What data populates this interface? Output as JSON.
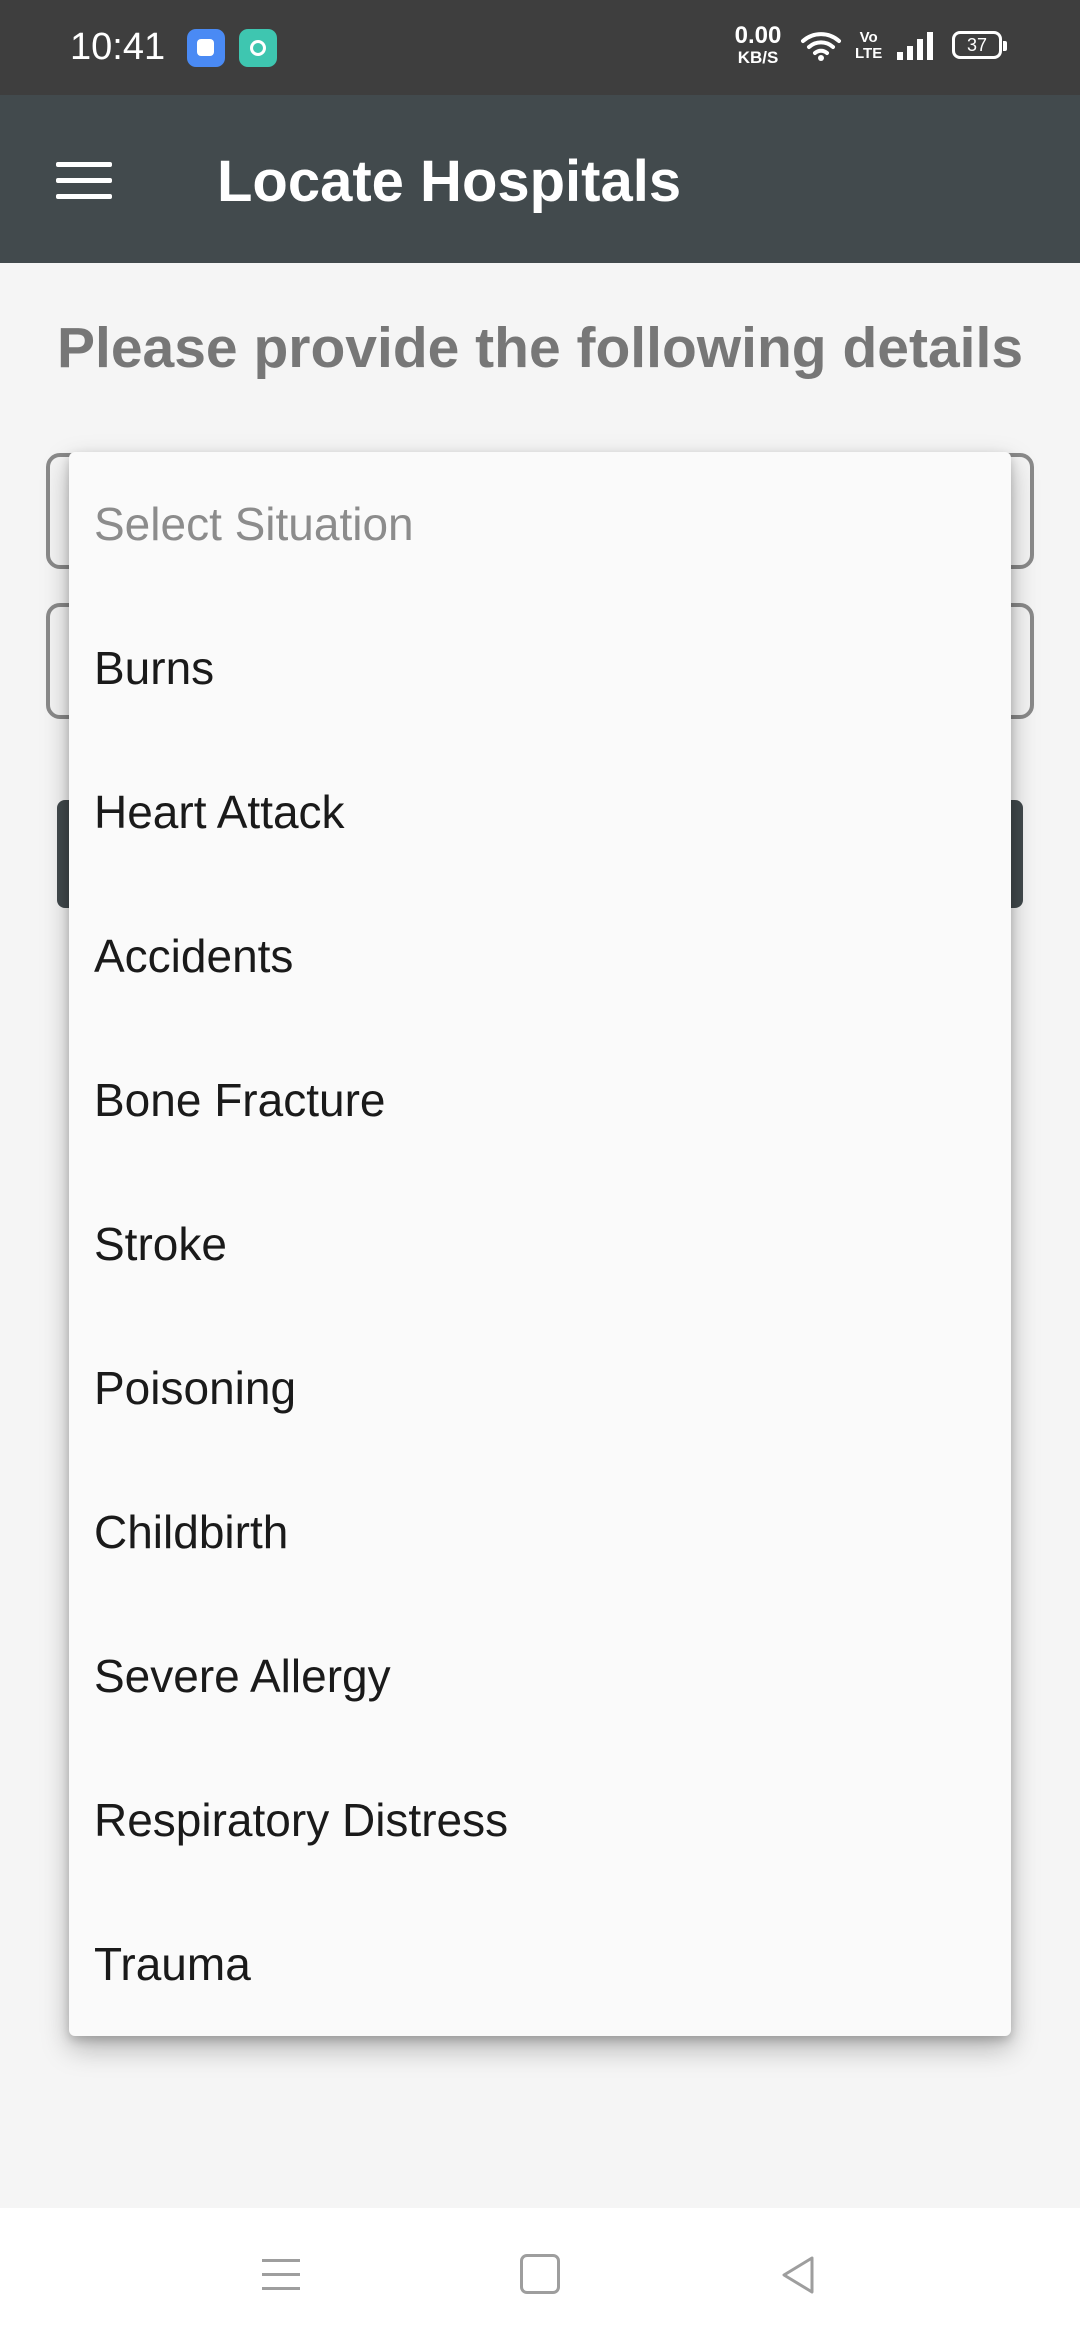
{
  "status_bar": {
    "time": "10:41",
    "net_speed_value": "0.00",
    "net_speed_unit": "KB/S",
    "volte_top": "Vo",
    "volte_bottom": "LTE",
    "battery": "37",
    "notification_icons": [
      "blue-app-icon",
      "teal-app-icon"
    ]
  },
  "app_bar": {
    "title": "Locate Hospitals",
    "menu_icon": "hamburger-menu-icon"
  },
  "content": {
    "heading": "Please provide the following details"
  },
  "dropdown": {
    "placeholder": "Select Situation",
    "options": [
      "Burns",
      "Heart Attack",
      "Accidents",
      "Bone Fracture",
      "Stroke",
      "Poisoning",
      "Childbirth",
      "Severe Allergy",
      "Respiratory Distress",
      "Trauma"
    ]
  },
  "nav_bar": {
    "icons": [
      "recent-apps-icon",
      "home-icon",
      "back-icon"
    ]
  },
  "colors": {
    "status_bar": "#3e3e3e",
    "app_bar": "#424a4d",
    "heading_text": "#777777",
    "background": "#f5f5f5"
  }
}
